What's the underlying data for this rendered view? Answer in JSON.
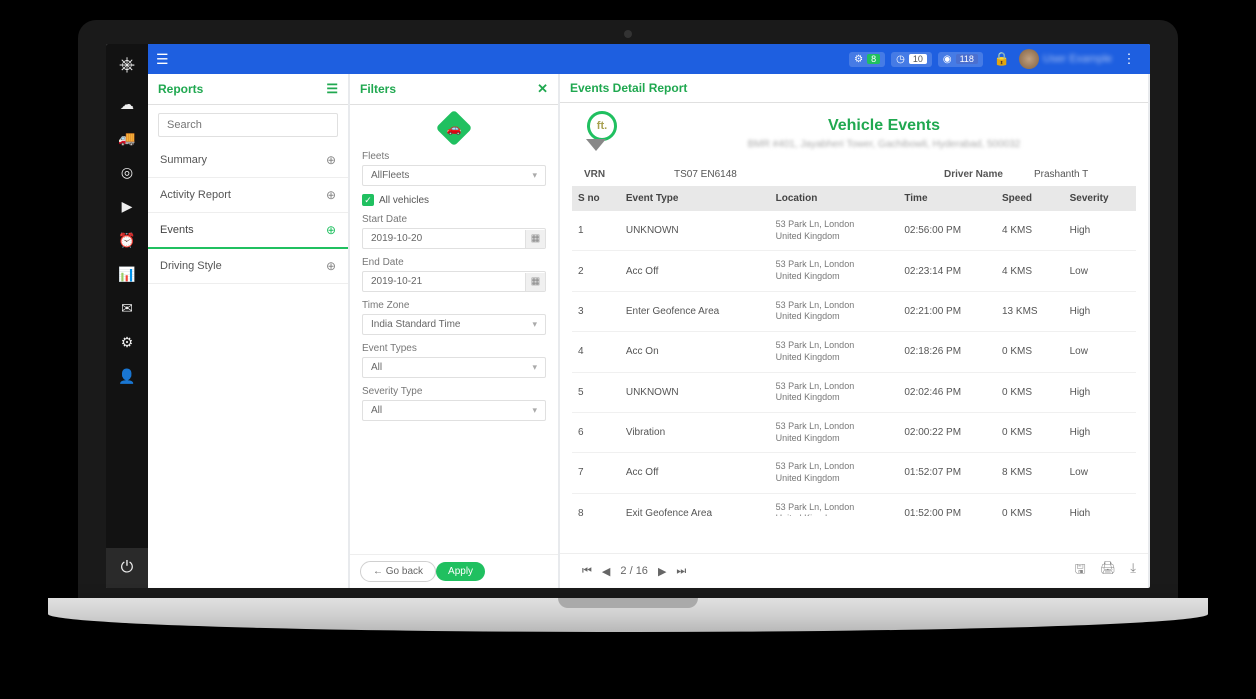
{
  "topbar": {
    "badges": [
      {
        "count": "8"
      },
      {
        "count": "10"
      },
      {
        "count": "118"
      }
    ],
    "user_name": "User Example"
  },
  "reports_panel": {
    "title": "Reports",
    "search_placeholder": "Search",
    "items": [
      {
        "label": "Summary",
        "active": false
      },
      {
        "label": "Activity Report",
        "active": false
      },
      {
        "label": "Events",
        "active": true
      },
      {
        "label": "Driving Style",
        "active": false
      }
    ]
  },
  "filters_panel": {
    "title": "Filters",
    "fleets_label": "Fleets",
    "fleets_value": "AllFleets",
    "all_vehicles_label": "All vehicles",
    "start_date_label": "Start Date",
    "start_date_value": "2019-10-20",
    "end_date_label": "End Date",
    "end_date_value": "2019-10-21",
    "timezone_label": "Time Zone",
    "timezone_value": "India Standard Time",
    "event_types_label": "Event Types",
    "event_types_value": "All",
    "severity_label": "Severity Type",
    "severity_value": "All",
    "go_back_label": "← Go back",
    "apply_label": "Apply"
  },
  "detail": {
    "title": "Events Detail Report",
    "report_title": "Vehicle Events",
    "report_subtitle": "BMR #401, Jayabheri Tower, Gachibowli, Hyderabad, 500032",
    "vrn_label": "VRN",
    "vrn_value": "TS07 EN6148",
    "driver_label": "Driver Name",
    "driver_value": "Prashanth T",
    "columns": {
      "sno": "S no",
      "event_type": "Event Type",
      "location": "Location",
      "time": "Time",
      "speed": "Speed",
      "severity": "Severity"
    },
    "rows": [
      {
        "n": "1",
        "type": "UNKNOWN",
        "loc1": "53 Park Ln, London",
        "loc2": "United Kingdom",
        "time": "02:56:00 PM",
        "speed": "4 KMS",
        "sev": "High"
      },
      {
        "n": "2",
        "type": "Acc Off",
        "loc1": "53 Park Ln, London",
        "loc2": "United Kingdom",
        "time": "02:23:14 PM",
        "speed": "4 KMS",
        "sev": "Low"
      },
      {
        "n": "3",
        "type": "Enter Geofence Area",
        "loc1": "53 Park Ln, London",
        "loc2": "United Kingdom",
        "time": "02:21:00 PM",
        "speed": "13 KMS",
        "sev": "High"
      },
      {
        "n": "4",
        "type": "Acc On",
        "loc1": "53 Park Ln, London",
        "loc2": "United Kingdom",
        "time": "02:18:26 PM",
        "speed": "0 KMS",
        "sev": "Low"
      },
      {
        "n": "5",
        "type": "UNKNOWN",
        "loc1": "53 Park Ln, London",
        "loc2": "United Kingdom",
        "time": "02:02:46 PM",
        "speed": "0 KMS",
        "sev": "High"
      },
      {
        "n": "6",
        "type": "Vibration",
        "loc1": "53 Park Ln, London",
        "loc2": "United Kingdom",
        "time": "02:00:22 PM",
        "speed": "0 KMS",
        "sev": "High"
      },
      {
        "n": "7",
        "type": "Acc Off",
        "loc1": "53 Park Ln, London",
        "loc2": "United Kingdom",
        "time": "01:52:07 PM",
        "speed": "8 KMS",
        "sev": "Low"
      },
      {
        "n": "8",
        "type": "Exit Geofence Area",
        "loc1": "53 Park Ln, London",
        "loc2": "United Kingdom",
        "time": "01:52:00 PM",
        "speed": "0 KMS",
        "sev": "High"
      }
    ],
    "pager": {
      "page": "2",
      "sep": "/",
      "total": "16"
    }
  }
}
